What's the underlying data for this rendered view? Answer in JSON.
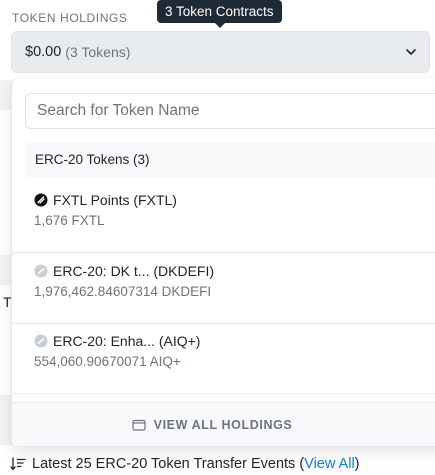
{
  "section_label": "TOKEN HOLDINGS",
  "tooltip": "3 Token Contracts",
  "holdings_select": {
    "value": "$0.00",
    "count": "(3 Tokens)"
  },
  "background_letter": "T",
  "dropdown": {
    "search_placeholder": "Search for Token Name",
    "group_header": "ERC-20 Tokens (3)",
    "tokens": [
      {
        "name": "FXTL Points (FXTL)",
        "balance": "1,676 FXTL",
        "icon": "fxtl-token-icon"
      },
      {
        "name": "ERC-20: DK t... (DKDEFI)",
        "balance": "1,976,462.84607314 DKDEFI",
        "icon": "generic-token-icon"
      },
      {
        "name": "ERC-20: Enha... (AIQ+)",
        "balance": "554,060.90670071 AIQ+",
        "icon": "generic-token-icon"
      }
    ],
    "view_all_label": "VIEW ALL HOLDINGS"
  },
  "transfer_events": {
    "text_before": "Latest 25 ERC-20 Token Transfer Events (",
    "link": "View All",
    "text_after": ")"
  },
  "colors": {
    "link": "#0784c3",
    "tooltip_bg": "#1f2a37",
    "muted_text": "#6c757d"
  }
}
